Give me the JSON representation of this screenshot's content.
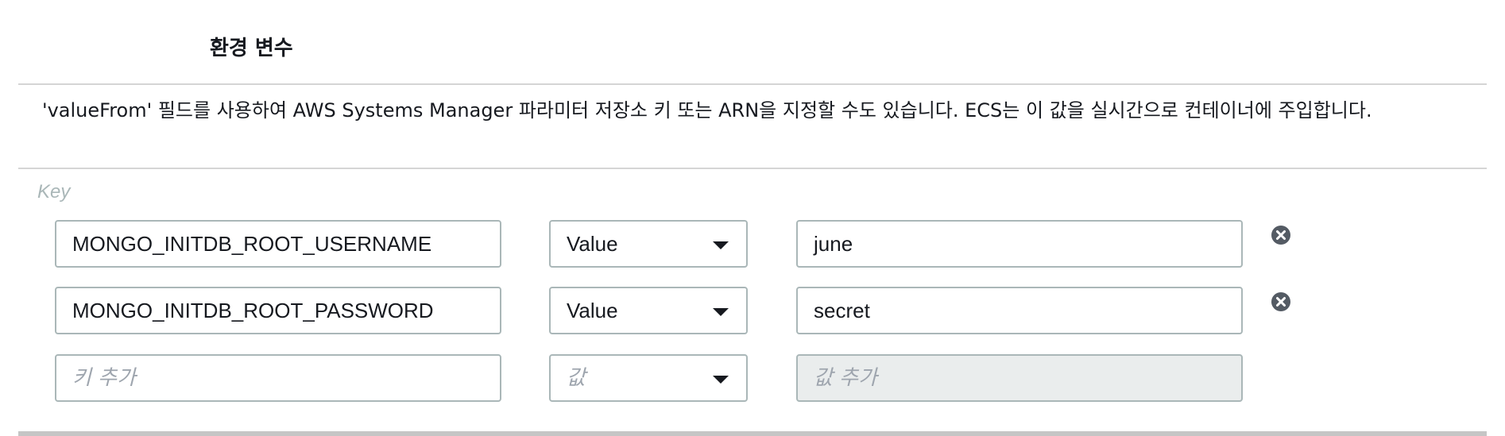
{
  "section": {
    "title": "환경 변수"
  },
  "description": "'valueFrom' 필드를 사용하여 AWS Systems Manager 파라미터 저장소 키 또는 ARN을 지정할 수도 있습니다. ECS는 이 값을 실시간으로 컨테이너에 주입합니다.",
  "columns": {
    "key_label": "Key"
  },
  "rows": [
    {
      "key": "MONGO_INITDB_ROOT_USERNAME",
      "type": "Value",
      "value": "june",
      "remove_icon": "close-circle-icon"
    },
    {
      "key": "MONGO_INITDB_ROOT_PASSWORD",
      "type": "Value",
      "value": "secret",
      "remove_icon": "close-circle-icon"
    }
  ],
  "new_row": {
    "key_placeholder": "키 추가",
    "type_placeholder": "값",
    "value_placeholder": "값 추가"
  },
  "icons": {
    "dropdown": "caret-down-icon"
  },
  "colors": {
    "border": "#aab7b8",
    "text": "#16191f",
    "disabled_bg": "#eaeded",
    "rule": "#d5d5d5"
  }
}
